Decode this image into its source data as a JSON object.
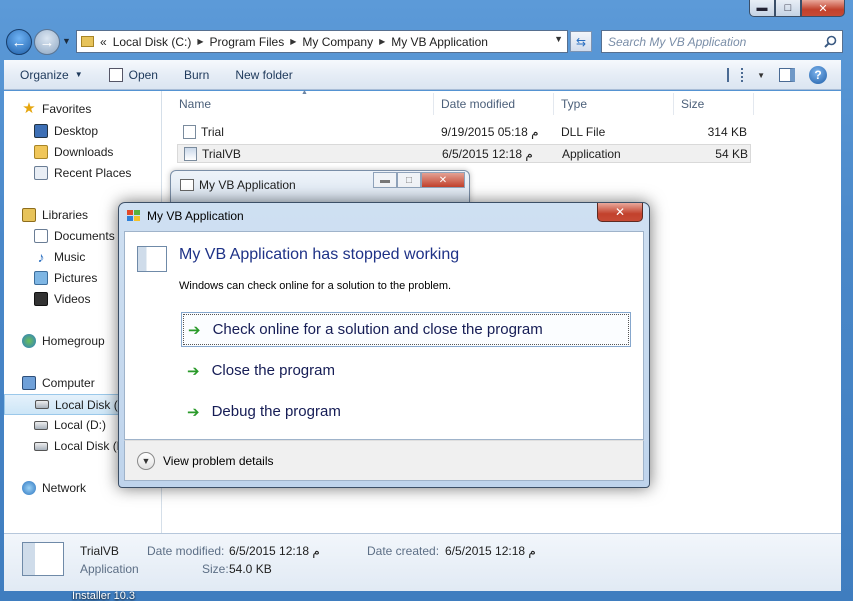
{
  "desktop": {
    "caption": "Installer 10.3"
  },
  "window": {
    "minimize": "▬",
    "maximize": "□",
    "close": "✕"
  },
  "nav": {
    "back": "←",
    "forward": "→",
    "history": "▼",
    "address_prefix": "«",
    "breadcrumb": [
      "Local Disk (C:)",
      "Program Files",
      "My Company",
      "My VB Application"
    ],
    "search_placeholder": "Search My VB Application"
  },
  "toolbar": {
    "organize": "Organize",
    "open": "Open",
    "burn": "Burn",
    "new_folder": "New folder"
  },
  "sidebar": {
    "favorites": "Favorites",
    "desktop": "Desktop",
    "downloads": "Downloads",
    "recent": "Recent Places",
    "libraries": "Libraries",
    "documents": "Documents",
    "music": "Music",
    "pictures": "Pictures",
    "videos": "Videos",
    "homegroup": "Homegroup",
    "computer": "Computer",
    "local_c": "Local Disk (C",
    "local_d": "Local (D:)",
    "local_e": "Local Disk (E",
    "network": "Network"
  },
  "columns": {
    "name": "Name",
    "date": "Date modified",
    "type": "Type",
    "size": "Size"
  },
  "files": [
    {
      "name": "Trial",
      "date": "9/19/2015 05:18 م",
      "type": "DLL File",
      "size": "314 KB"
    },
    {
      "name": "TrialVB",
      "date": "6/5/2015 12:18 م",
      "type": "Application",
      "size": "54 KB"
    }
  ],
  "details": {
    "name": "TrialVB",
    "type": "Application",
    "modified_label": "Date modified:",
    "modified_value": "6/5/2015 12:18 م",
    "created_label": "Date created:",
    "created_value": "6/5/2015 12:18 م",
    "size_label": "Size:",
    "size_value": "54.0 KB"
  },
  "behind_dialog": {
    "title": "My VB Application"
  },
  "dialog": {
    "title": "My VB Application",
    "heading": "My VB Application has stopped working",
    "subtext": "Windows can check online for a solution to the problem.",
    "options": [
      "Check online for a solution and close the program",
      "Close the program",
      "Debug the program"
    ],
    "details_label": "View problem details"
  },
  "colors": {
    "accent": "#1e3287",
    "arrow_green": "#2a9a2a",
    "close_red": "#c2412c"
  }
}
